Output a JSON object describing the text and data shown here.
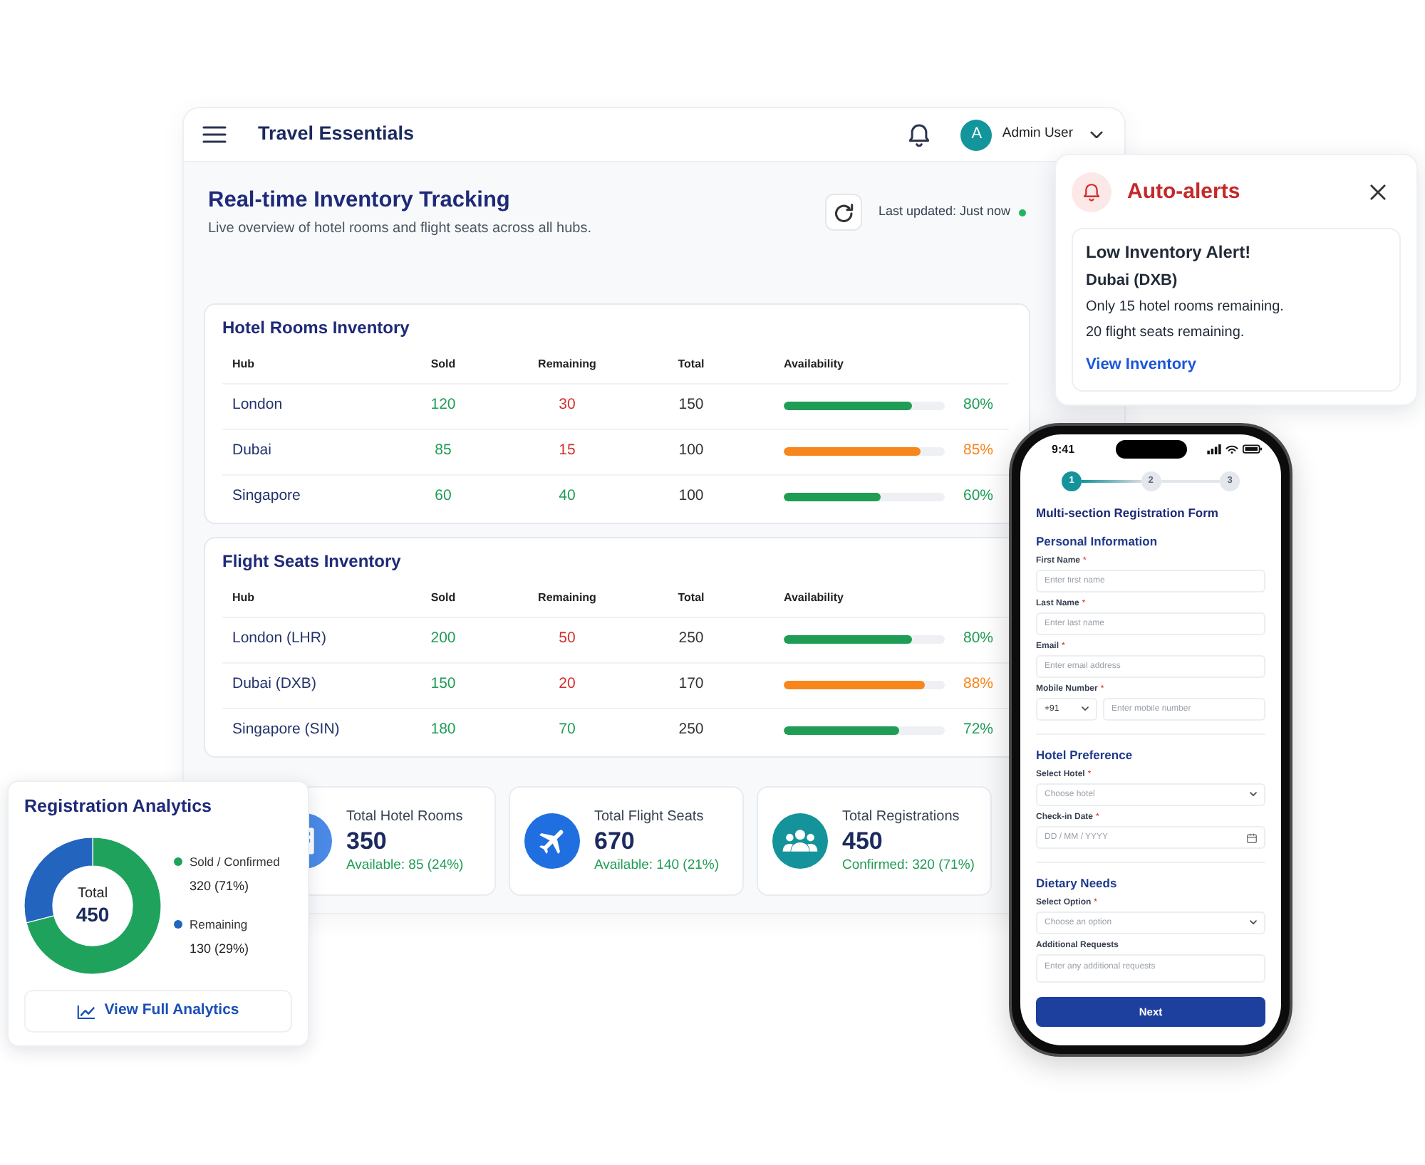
{
  "dashboard": {
    "brand": "Travel Essentials",
    "user": {
      "initial": "A",
      "name": "Admin User"
    },
    "title": "Real-time Inventory Tracking",
    "subtitle": "Live overview of hotel rooms and flight seats across all hubs.",
    "last_updated": "Last updated: Just now",
    "tables": [
      {
        "title": "Hotel Rooms Inventory",
        "columns": [
          "Hub",
          "Sold",
          "Remaining",
          "Total",
          "Availability"
        ],
        "rows": [
          {
            "hub": "London",
            "sold": "120",
            "remaining": "30",
            "remaining_low": true,
            "total": "150",
            "level": 0.8,
            "percent": "80%",
            "color": "#1f9d55"
          },
          {
            "hub": "Dubai",
            "sold": "85",
            "remaining": "15",
            "remaining_low": true,
            "total": "100",
            "level": 0.85,
            "percent": "85%",
            "color": "#f7861c"
          },
          {
            "hub": "Singapore",
            "sold": "60",
            "remaining": "40",
            "remaining_low": false,
            "total": "100",
            "level": 0.6,
            "percent": "60%",
            "color": "#1f9d55"
          }
        ]
      },
      {
        "title": "Flight Seats Inventory",
        "columns": [
          "Hub",
          "Sold",
          "Remaining",
          "Total",
          "Availability"
        ],
        "rows": [
          {
            "hub": "London (LHR)",
            "sold": "200",
            "remaining": "50",
            "remaining_low": true,
            "total": "250",
            "level": 0.8,
            "percent": "80%",
            "color": "#1f9d55"
          },
          {
            "hub": "Dubai (DXB)",
            "sold": "150",
            "remaining": "20",
            "remaining_low": true,
            "total": "170",
            "level": 0.88,
            "percent": "88%",
            "color": "#f7861c"
          },
          {
            "hub": "Singapore (SIN)",
            "sold": "180",
            "remaining": "70",
            "remaining_low": false,
            "total": "250",
            "level": 0.72,
            "percent": "72%",
            "color": "#1f9d55"
          }
        ]
      }
    ],
    "stats": [
      {
        "kind": "hotel",
        "title": "Total Hotel Rooms",
        "value": "350",
        "note": "Available: 85 (24%)"
      },
      {
        "kind": "flight",
        "title": "Total Flight Seats",
        "value": "670",
        "note": "Available: 140 (21%)"
      },
      {
        "kind": "registrations",
        "title": "Total Registrations",
        "value": "450",
        "note": "Confirmed: 320 (71%)"
      }
    ]
  },
  "alert": {
    "title": "Auto-alerts",
    "heading": "Low Inventory Alert!",
    "location": "Dubai (DXB)",
    "lines": [
      "Only 15 hotel rooms remaining.",
      "20 flight seats remaining."
    ],
    "link": "View Inventory"
  },
  "analytics": {
    "title": "Registration Analytics",
    "total_label": "Total",
    "total_value": "450",
    "chart_data": {
      "type": "donut",
      "categories": [
        "Sold / Confirmed",
        "Remaining"
      ],
      "values": [
        71,
        29
      ]
    },
    "legend": [
      {
        "value": "320 (71%)",
        "color": "#1fa35c"
      },
      {
        "value": "130 (29%)",
        "color": "#2364bf"
      }
    ],
    "button": "View Full Analytics"
  },
  "phone": {
    "time": "9:41",
    "steps": [
      {
        "label": "1",
        "selected": true
      },
      {
        "label": "2",
        "selected": false
      },
      {
        "label": "3",
        "selected": false
      }
    ],
    "title": "Multi-section Registration Form",
    "sections": [
      {
        "title": "Personal Information",
        "fields": [
          {
            "kind": "text",
            "label": "First Name",
            "required_mark": "*",
            "placeholder": "Enter first name"
          },
          {
            "kind": "text",
            "label": "Last Name",
            "required_mark": "*",
            "placeholder": "Enter last name"
          },
          {
            "kind": "text",
            "label": "Email",
            "required_mark": "*",
            "placeholder": "Enter email address"
          },
          {
            "kind": "phone",
            "label": "Mobile Number",
            "required_mark": "*",
            "code": "+91",
            "placeholder": "Enter mobile number"
          }
        ]
      },
      {
        "title": "Hotel Preference",
        "fields": [
          {
            "kind": "select",
            "label": "Select Hotel",
            "required_mark": "*",
            "placeholder": "Choose hotel"
          },
          {
            "kind": "date",
            "label": "Check-in Date",
            "required_mark": "*",
            "placeholder": "DD / MM / YYYY"
          }
        ]
      },
      {
        "title": "Dietary Needs",
        "fields": [
          {
            "kind": "select",
            "label": "Select Option",
            "required_mark": "*",
            "placeholder": "Choose an option"
          },
          {
            "kind": "textarea",
            "label": "Additional Requests",
            "placeholder": "Enter any additional requests"
          }
        ]
      }
    ],
    "button": "Next"
  }
}
